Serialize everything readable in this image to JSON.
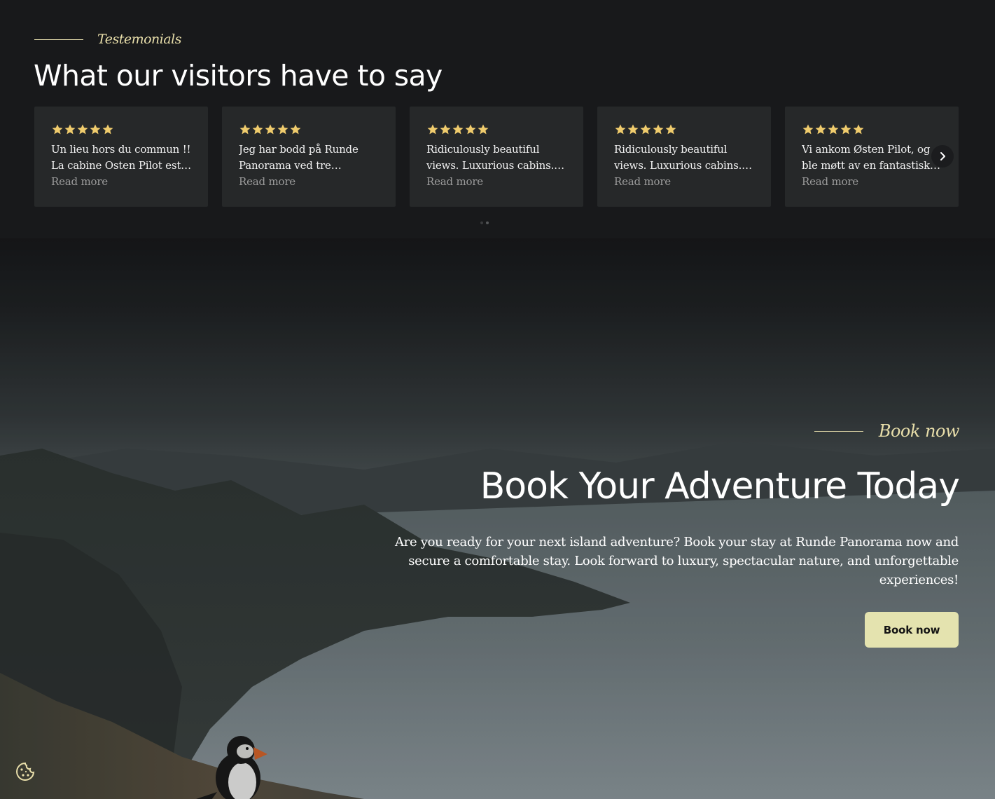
{
  "testimonials": {
    "eyebrow": "Testemonials",
    "heading": "What our visitors have to say",
    "star_color": "#f0cc6d",
    "reviews": [
      {
        "rating": 5,
        "text": "Un lieu hors du commun !! La cabine Osten Pilot est…",
        "read_more": "Read more"
      },
      {
        "rating": 5,
        "text": "Jeg har bodd på Runde Panorama ved tre…",
        "read_more": "Read more"
      },
      {
        "rating": 5,
        "text": "Ridiculously beautiful views. Luxurious cabins.…",
        "read_more": "Read more"
      },
      {
        "rating": 5,
        "text": "Ridiculously beautiful views. Luxurious cabins.…",
        "read_more": "Read more"
      },
      {
        "rating": 5,
        "text": "Vi ankom Østen Pilot, og ble møtt av en fantastisk…",
        "read_more": "Read more"
      }
    ],
    "next_icon": "chevron-right-icon",
    "pagination": {
      "pages": 2,
      "active": 2
    }
  },
  "booking": {
    "eyebrow": "Book now",
    "heading": "Book Your Adventure Today",
    "description": "Are you ready for your next island adventure? Book your stay at Runde Panorama now and secure a comfortable stay. Look forward to luxury, spectacular nature, and unforgettable experiences!",
    "button_label": "Book now",
    "button_color": "#e4e3af"
  },
  "cookie_icon": "cookie-icon"
}
